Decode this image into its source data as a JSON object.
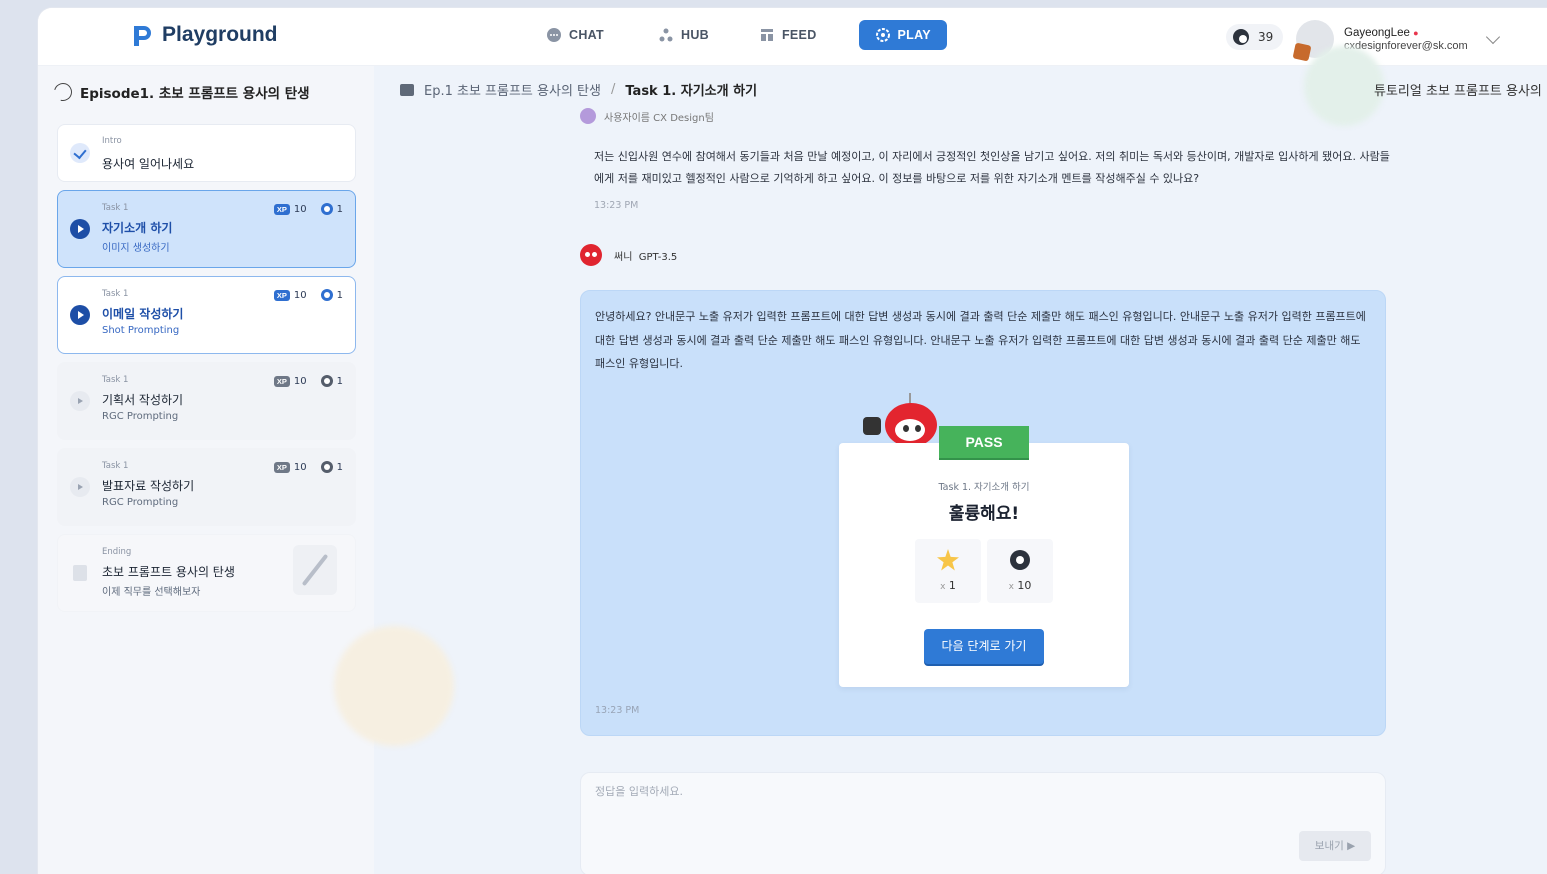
{
  "app": {
    "name": "Playground"
  },
  "nav": {
    "items": [
      {
        "label": "CHAT",
        "icon": "chat-icon",
        "active": false
      },
      {
        "label": "HUB",
        "icon": "hub-icon",
        "active": false
      },
      {
        "label": "FEED",
        "icon": "feed-icon",
        "active": false
      },
      {
        "label": "PLAY",
        "icon": "play-gear-icon",
        "active": true
      }
    ]
  },
  "coins": {
    "value": "39"
  },
  "user": {
    "name": "GayeongLee",
    "email": "cxdesignforever@sk.com"
  },
  "sidebar": {
    "episode_title": "Episode1. 초보 프롬프트 용사의 탄생",
    "tasks": [
      {
        "category": "Intro",
        "name": "용사여 일어나세요",
        "sub": "",
        "status": "done"
      },
      {
        "category": "Task 1",
        "name": "자기소개 하기",
        "sub": "이미지 생성하기",
        "xp": "10",
        "gem": "1",
        "status": "active"
      },
      {
        "category": "Task 1",
        "name": "이메일 작성하기",
        "sub": "Shot Prompting",
        "xp": "10",
        "gem": "1",
        "status": "open"
      },
      {
        "category": "Task 1",
        "name": "기획서 작성하기",
        "sub": "RGC Prompting",
        "xp": "10",
        "gem": "1",
        "status": "locked"
      },
      {
        "category": "Task 1",
        "name": "발표자료 작성하기",
        "sub": "RGC Prompting",
        "xp": "10",
        "gem": "1",
        "status": "locked"
      },
      {
        "category": "Ending",
        "name": "초보 프롬프트 용사의 탄생",
        "sub": "이제 직무를 선택해보자",
        "status": "ending"
      }
    ]
  },
  "breadcrumb": {
    "episode": "Ep.1 초보 프롬프트 용사의 탄생",
    "separator": "/",
    "task": "Task 1. 자기소개 하기"
  },
  "tutorial_link": "튜토리얼  초보 프롬프트 용사의 탄",
  "chat": {
    "user_meta": "사용자이름  CX Design팀",
    "user_message": "저는 신입사원 연수에 참여해서 동기들과 처음 만날 예정이고, 이 자리에서 긍정적인 첫인상을 남기고 싶어요. 저의 취미는 독서와 등산이며, 개발자로 입사하게 됐어요. 사람들에게 저를 재미있고 헬정적인 사람으로 기억하게 하고 싶어요. 이 정보를 바탕으로 저를 위한 자기소개 멘트를 작성해주실 수 있나요?",
    "user_time": "13:23 PM",
    "bot_name": "써니",
    "bot_model": "GPT-3.5",
    "bot_message": "안녕하세요? 안내문구 노출 유저가 입력한 프롬프트에 대한 답변 생성과 동시에 결과 출력 단순 제출만 해도 패스인 유형입니다. 안내문구 노출 유저가 입력한 프롬프트에 대한 답변 생성과 동시에 결과 출력 단순 제출만 해도 패스인 유형입니다. 안내문구 노출 유저가 입력한 프롬프트에 대한 답변 생성과 동시에 결과 출력 단순 제출만 해도 패스인 유형입니다.",
    "bot_time": "13:23 PM"
  },
  "result": {
    "badge": "PASS",
    "task_label": "Task 1. 자기소개 하기",
    "title": "훌륭해요!",
    "rewards": [
      {
        "icon": "star-icon",
        "mult": "x",
        "count": "1"
      },
      {
        "icon": "gem-icon",
        "mult": "x",
        "count": "10"
      }
    ],
    "next_button": "다음 단계로 가기"
  },
  "composer": {
    "placeholder": "정답을 입력하세요.",
    "send_label": "보내기 ▶"
  }
}
